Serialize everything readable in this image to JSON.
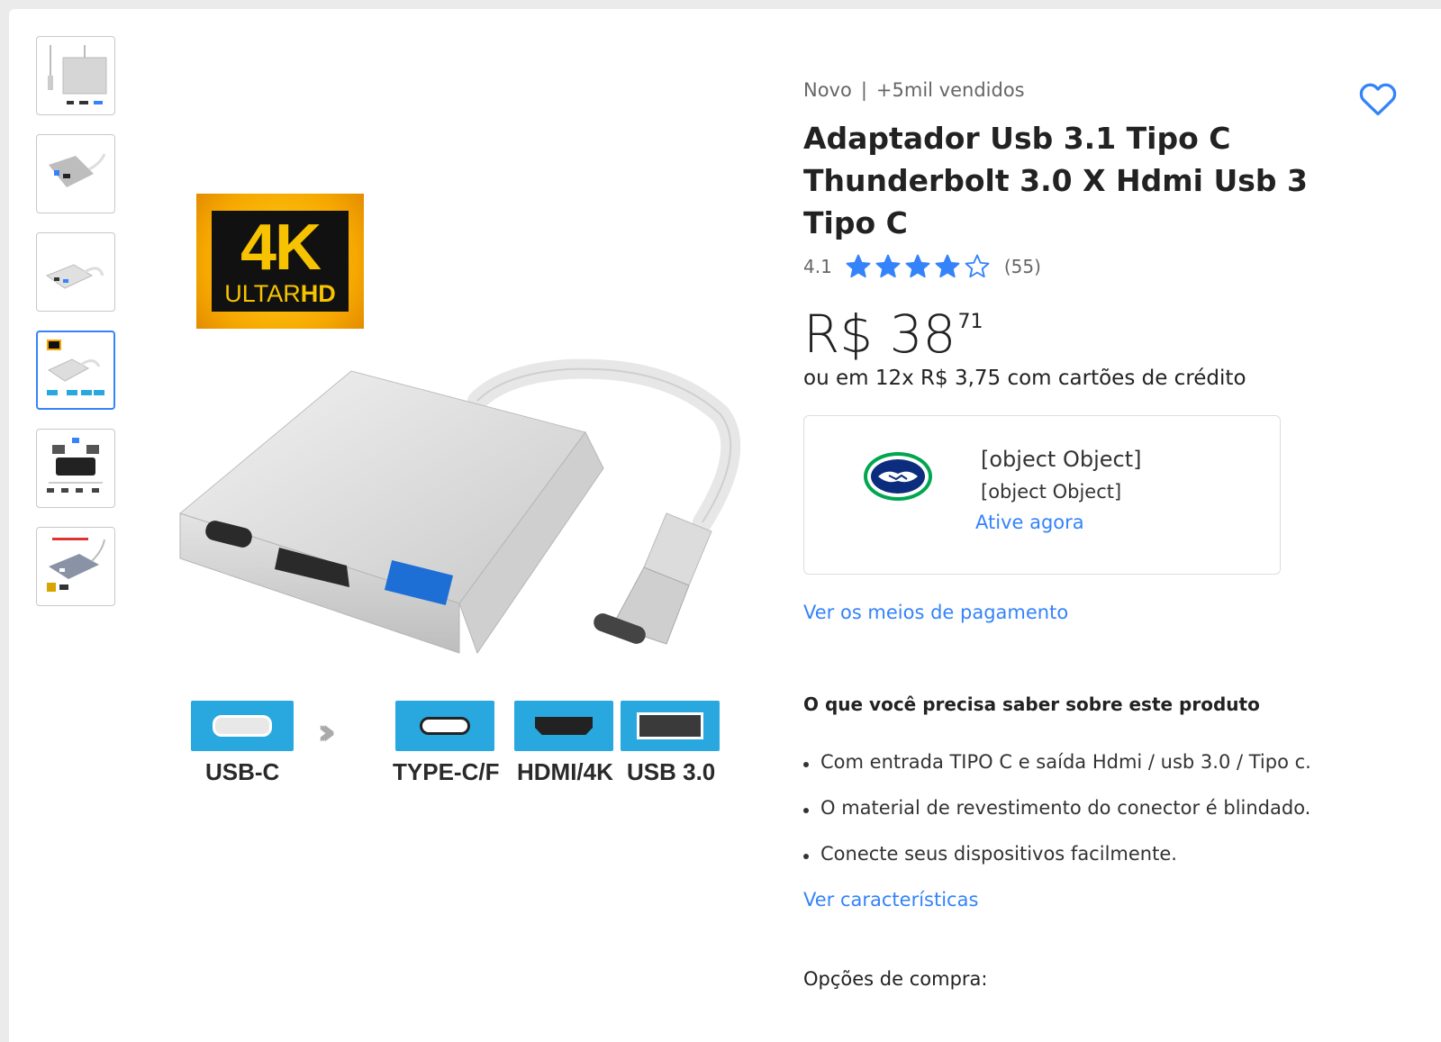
{
  "product": {
    "condition": "Novo",
    "separator": "|",
    "sold": "+5mil vendidos",
    "title": "Adaptador Usb 3.1 Tipo C Thunderbolt 3.0 X Hdmi Usb 3 Tipo C",
    "rating": "4.1",
    "rating_value": 4.1,
    "rating_max": 5,
    "reviews": "(55)",
    "price_main": "R$ 38",
    "price_cents": "71",
    "installments": "ou em 12x R$ 3,75 com cartões de crédito"
  },
  "mercadopago": {
    "line1": "[object Object]",
    "line2": "[object Object]",
    "action": "Ative agora"
  },
  "links": {
    "payment_methods": "Ver os meios de pagamento",
    "features": "Ver características"
  },
  "about": {
    "title": "O que você precisa saber sobre este produto",
    "items": [
      "Com entrada TIPO C e saída Hdmi / usb 3.0 / Tipo c.",
      "O material de revestimento do conector é blindado.",
      "Conecte seus dispositivos facilmente."
    ]
  },
  "purchase_options": "Opções de compra:",
  "image": {
    "badge_main": "4K",
    "badge_sub_light": "ULTAR",
    "badge_sub_bold": "HD",
    "ports": [
      "USB-C",
      "TYPE-C/F",
      "HDMI/4K",
      "USB 3.0"
    ]
  },
  "thumbnails": {
    "count": 6,
    "active_index": 3
  },
  "colors": {
    "accent": "#3483fa",
    "background": "#ebebeb",
    "star": "#3483fa"
  }
}
